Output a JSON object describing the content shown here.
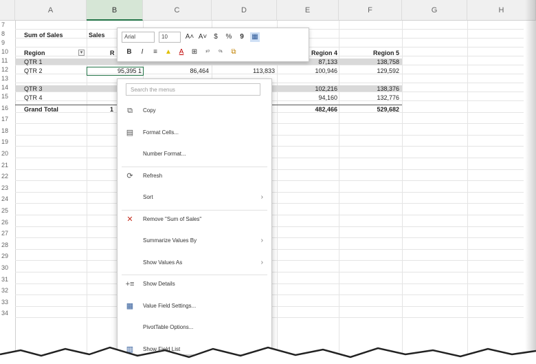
{
  "columns": [
    "A",
    "B",
    "C",
    "D",
    "E",
    "F",
    "G",
    "H"
  ],
  "rows": [
    "7",
    "8",
    "9",
    "10",
    "11",
    "12",
    "13",
    "14",
    "15",
    "16",
    "17",
    "18",
    "19",
    "20",
    "21",
    "22",
    "23",
    "24",
    "25",
    "26",
    "27",
    "28",
    "29",
    "30",
    "31",
    "32",
    "33",
    "34"
  ],
  "pivot": {
    "title_a": "Sum of Sales",
    "title_b": "Sales",
    "header_a": "Region",
    "header_b": "R",
    "header_e": "Region 4",
    "header_f": "Region 5",
    "rows": [
      {
        "label": "QTR 1",
        "b": "",
        "c": "",
        "d": "",
        "e": "87,133",
        "f": "138,758"
      },
      {
        "label": "QTR 2",
        "b": "95,395 1",
        "c": "86,464",
        "d": "113,833",
        "e": "100,946",
        "f": "129,592"
      },
      {
        "label": "QTR 3",
        "b": "",
        "c": "",
        "d": "",
        "e": "102,216",
        "f": "138,376"
      },
      {
        "label": "QTR 4",
        "b": "",
        "c": "",
        "d": "",
        "e": "94,160",
        "f": "132,776"
      }
    ],
    "grand_total_label": "Grand Total",
    "grand_total_b": "1",
    "grand_total_e": "482,466",
    "grand_total_f": "529,682"
  },
  "mini_toolbar": {
    "font": "Arial",
    "size": "10",
    "grow": "A˄",
    "shrink": "A˅",
    "currency": "$",
    "percent": "%",
    "comma": "9",
    "bold": "B",
    "italic": "I",
    "align": "≡",
    "fill": "▲",
    "font_color": "A",
    "borders": "⊞",
    "dec_inc": "¹⁰",
    "dec_dec": "⁰¹",
    "clear": "⧉"
  },
  "context_menu": {
    "search_placeholder": "Search the menus",
    "items": [
      {
        "label": "Copy",
        "icon": "copy-icon",
        "glyph": "⧉",
        "submenu": false
      },
      {
        "label": "Format Cells...",
        "icon": "format-cells-icon",
        "glyph": "▤",
        "submenu": false
      },
      {
        "label": "Number Format...",
        "icon": "",
        "glyph": "",
        "submenu": false
      },
      {
        "label": "Refresh",
        "icon": "refresh-icon",
        "glyph": "⟳",
        "submenu": false
      },
      {
        "label": "Sort",
        "icon": "",
        "glyph": "",
        "submenu": true
      },
      {
        "label": "Remove \"Sum of Sales\"",
        "icon": "remove-icon",
        "glyph": "✕",
        "submenu": false
      },
      {
        "label": "Summarize Values By",
        "icon": "",
        "glyph": "",
        "submenu": true
      },
      {
        "label": "Show Values As",
        "icon": "",
        "glyph": "",
        "submenu": true
      },
      {
        "label": "Show Details",
        "icon": "show-details-icon",
        "glyph": "+≡",
        "submenu": false
      },
      {
        "label": "Value Field Settings...",
        "icon": "value-field-settings-icon",
        "glyph": "▦",
        "submenu": false
      },
      {
        "label": "PivotTable Options...",
        "icon": "",
        "glyph": "",
        "submenu": false
      },
      {
        "label": "Show Field List",
        "icon": "field-list-icon",
        "glyph": "▥",
        "submenu": false
      }
    ],
    "submenu_arrow": "›"
  },
  "colors": {
    "accent": "#217346",
    "band": "#d9d9d9",
    "remove": "#c42b1c"
  }
}
